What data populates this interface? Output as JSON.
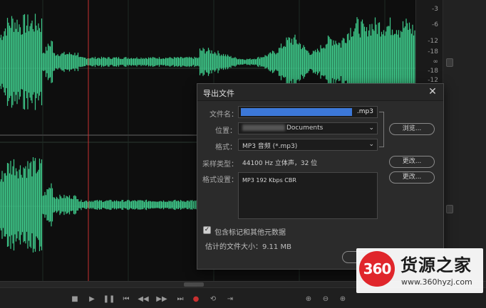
{
  "db_scale": [
    "-3",
    "-6",
    "-12",
    "-18",
    "∞",
    "-18",
    "-12"
  ],
  "export_dialog": {
    "title": "导出文件",
    "close_label": "✕",
    "filename_label": "文件名：",
    "filename_ext": ".mp3",
    "location_label": "位置：",
    "location_value": "Documents",
    "browse_label": "浏览...",
    "format_label": "格式：",
    "format_value": "MP3 音频 (*.mp3)",
    "sample_type_label": "采样类型：",
    "sample_type_value": "44100 Hz 立体声，32 位",
    "change_label_1": "更改...",
    "format_settings_label": "格式设置：",
    "format_settings_value": "MP3 192 Kbps CBR",
    "change_label_2": "更改...",
    "include_markers_label": "包含标记和其他元数据",
    "include_markers_checked": true,
    "estimated_size_label": "估计的文件大小：9.11 MB"
  },
  "watermark": {
    "logo_text": "360",
    "name": "货源之家",
    "url": "www.360hyzj.com"
  },
  "colors": {
    "waveform": "#3ec98a",
    "playhead": "#c83030",
    "selection": "#3c78d8",
    "annotation_arrow": "#e03030"
  }
}
